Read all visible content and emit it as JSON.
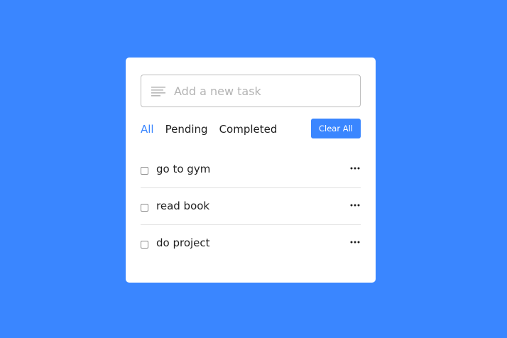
{
  "input": {
    "placeholder": "Add a new task",
    "value": "",
    "icon": "lines-icon"
  },
  "filters": [
    {
      "label": "All",
      "active": true
    },
    {
      "label": "Pending",
      "active": false
    },
    {
      "label": "Completed",
      "active": false
    }
  ],
  "clear_all_label": "Clear All",
  "tasks": [
    {
      "text": "go to gym",
      "checked": false
    },
    {
      "text": "read book",
      "checked": false
    },
    {
      "text": "do project",
      "checked": false
    }
  ],
  "colors": {
    "background": "#3a86ff",
    "accent": "#3a86ff",
    "card": "#ffffff",
    "text": "#1f1f1f",
    "placeholder": "#b3b3b3"
  }
}
